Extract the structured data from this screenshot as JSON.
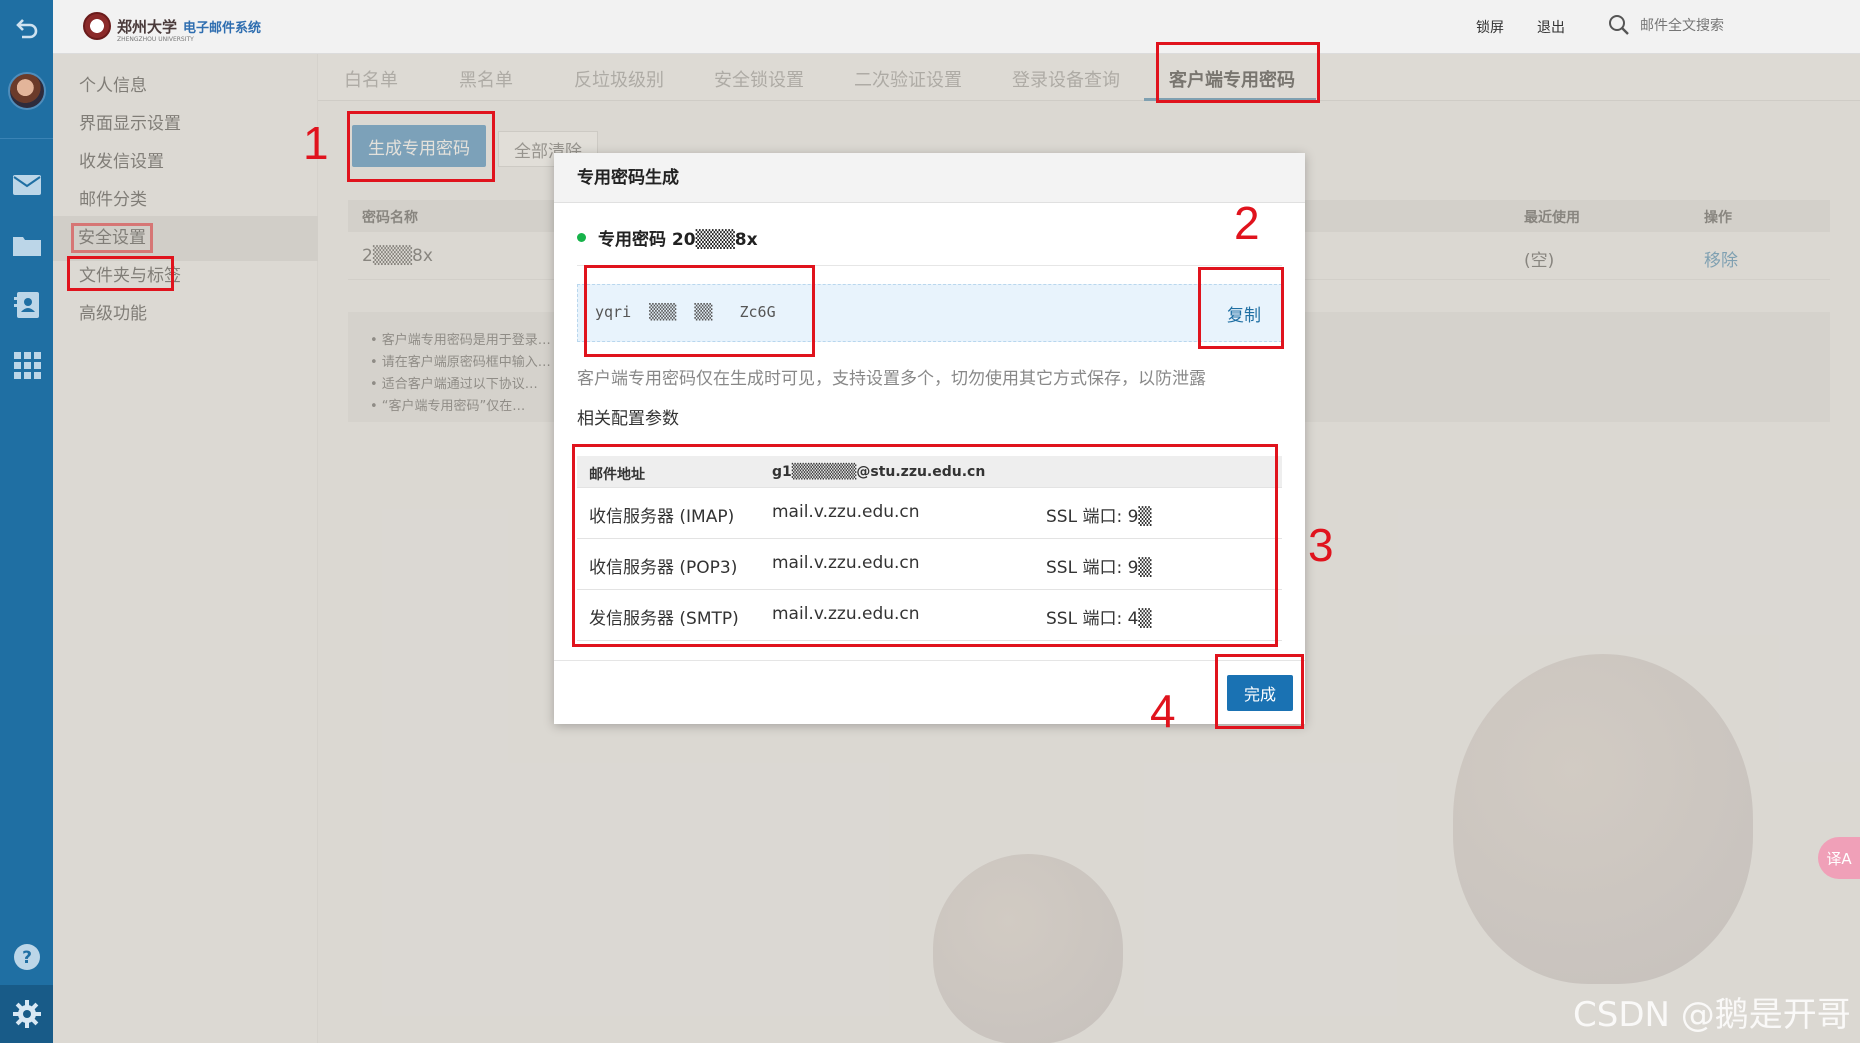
{
  "header": {
    "logo_text": "郑州大学",
    "logo_system": "电子邮件系统",
    "logo_sub": "ZHENGZHOU UNIVERSITY",
    "lock_label": "锁屏",
    "logout_label": "退出",
    "search_placeholder": "邮件全文搜索"
  },
  "rail": {
    "icons": [
      "back-icon",
      "avatar",
      "mail-icon",
      "folder-icon",
      "contacts-icon",
      "apps-icon",
      "help-icon",
      "gear-icon"
    ]
  },
  "menu": {
    "items": [
      {
        "label": "个人信息"
      },
      {
        "label": "界面显示设置"
      },
      {
        "label": "收发信设置"
      },
      {
        "label": "邮件分类"
      },
      {
        "label": "安全设置"
      },
      {
        "label": "文件夹与标签"
      },
      {
        "label": "高级功能"
      }
    ],
    "active_index": 4
  },
  "tabs": [
    {
      "label": "白名单"
    },
    {
      "label": "黑名单"
    },
    {
      "label": "反垃圾级别"
    },
    {
      "label": "安全锁设置"
    },
    {
      "label": "二次验证设置"
    },
    {
      "label": "登录设备查询"
    },
    {
      "label": "客户端专用密码"
    }
  ],
  "toolbar": {
    "generate_label": "生成专用密码",
    "clear_label": "全部清除"
  },
  "table": {
    "headers": {
      "name": "密码名称",
      "last_used": "最近使用",
      "action": "操作"
    },
    "rows": [
      {
        "name": "2▒▒▒8x",
        "last_used": "(空)",
        "action": "移除"
      }
    ]
  },
  "notes": [
    "• 客户端专用密码是用于登录…",
    "• 请在客户端原密码框中输入…",
    "• 适合客户端通过以下协议…",
    "• “客户端专用密码”仅在…"
  ],
  "modal": {
    "title": "专用密码生成",
    "password_title": "专用密码 20▒▒▒8x",
    "password_value": "yqri  ▒▒▒  ▒▒   Zc6G",
    "copy_label": "复制",
    "hint": "客户端专用密码仅在生成时可见，支持设置多个，切勿使用其它方式保存，以防泄露",
    "config_label": "相关配置参数",
    "config_head": {
      "label": "邮件地址",
      "value": "g1▒▒▒▒▒▒@stu.zzu.edu.cn"
    },
    "config_rows": [
      {
        "label": "收信服务器 (IMAP)",
        "host": "mail.v.zzu.edu.cn",
        "port": "SSL 端口: 9▒"
      },
      {
        "label": "收信服务器 (POP3)",
        "host": "mail.v.zzu.edu.cn",
        "port": "SSL 端口: 9▒"
      },
      {
        "label": "发信服务器 (SMTP)",
        "host": "mail.v.zzu.edu.cn",
        "port": "SSL 端口: 4▒"
      }
    ],
    "done_label": "完成"
  },
  "annotations": {
    "n1": "1",
    "n2": "2",
    "n3": "3",
    "n4": "4"
  },
  "watermark": "CSDN @鹅是开哥",
  "side_widget": "译A",
  "colors": {
    "accent": "#1a72b3",
    "rail": "#1f6fa3",
    "highlight": "#e0131d",
    "status_dot": "#17b34a"
  }
}
